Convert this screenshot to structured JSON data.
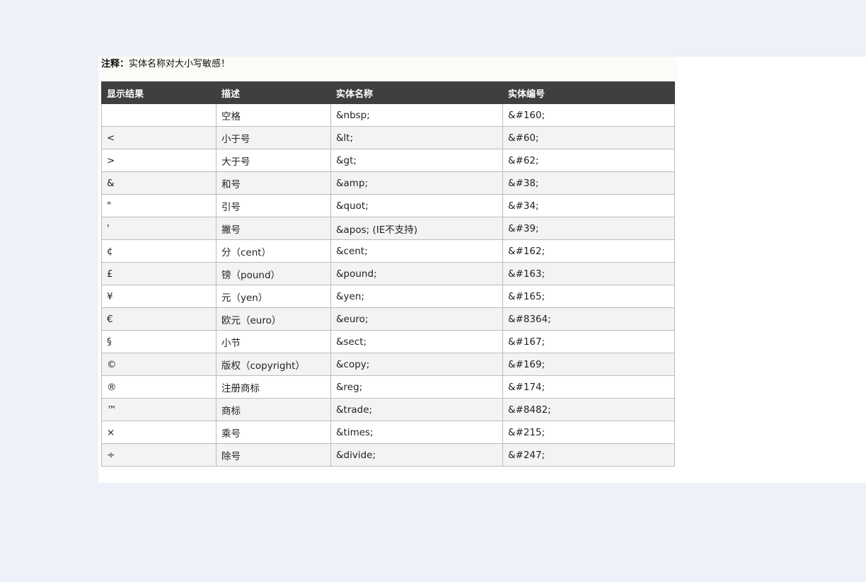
{
  "note": {
    "label": "注释：",
    "text": "实体名称对大小写敏感！"
  },
  "table": {
    "headers": [
      "显示结果",
      "描述",
      "实体名称",
      "实体编号"
    ],
    "rows": [
      [
        " ",
        "空格",
        "&nbsp;",
        "&#160;"
      ],
      [
        "<",
        "小于号",
        "&lt;",
        "&#60;"
      ],
      [
        ">",
        "大于号",
        "&gt;",
        "&#62;"
      ],
      [
        "&",
        "和号",
        "&amp;",
        "&#38;"
      ],
      [
        "\"",
        "引号",
        "&quot;",
        "&#34;"
      ],
      [
        "'",
        "撇号",
        "&apos; (IE不支持)",
        "&#39;"
      ],
      [
        "¢",
        "分（cent）",
        "&cent;",
        "&#162;"
      ],
      [
        "£",
        "镑（pound）",
        "&pound;",
        "&#163;"
      ],
      [
        "¥",
        "元（yen）",
        "&yen;",
        "&#165;"
      ],
      [
        "€",
        "欧元（euro）",
        "&euro;",
        "&#8364;"
      ],
      [
        "§",
        "小节",
        "&sect;",
        "&#167;"
      ],
      [
        "©",
        "版权（copyright）",
        "&copy;",
        "&#169;"
      ],
      [
        "®",
        "注册商标",
        "&reg;",
        "&#174;"
      ],
      [
        "™",
        "商标",
        "&trade;",
        "&#8482;"
      ],
      [
        "×",
        "乘号",
        "&times;",
        "&#215;"
      ],
      [
        "÷",
        "除号",
        "&divide;",
        "&#247;"
      ]
    ]
  }
}
